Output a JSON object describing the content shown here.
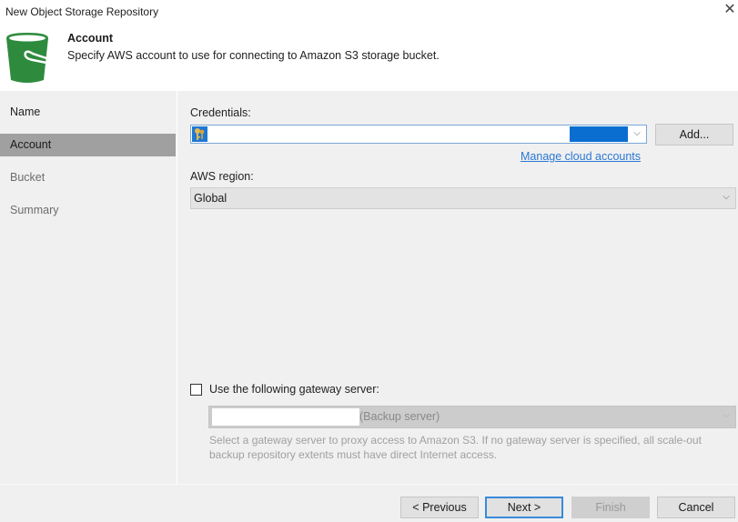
{
  "window": {
    "title": "New Object Storage Repository",
    "close_icon": "close-icon"
  },
  "header": {
    "icon": "s3-bucket-icon",
    "step_title": "Account",
    "step_description": "Specify AWS account to use for connecting to Amazon S3 storage bucket.",
    "accent_color": "#2e8b3e"
  },
  "sidebar": {
    "items": [
      {
        "label": "Name",
        "state": "done"
      },
      {
        "label": "Account",
        "state": "active"
      },
      {
        "label": "Bucket",
        "state": "pending"
      },
      {
        "label": "Summary",
        "state": "pending"
      }
    ]
  },
  "form": {
    "credentials_label": "Credentials:",
    "credentials_value": "",
    "credentials_icon": "key-icon",
    "add_button": "Add...",
    "manage_link": "Manage cloud accounts",
    "region_label": "AWS region:",
    "region_value": "Global",
    "gateway_checkbox_label": "Use the following gateway server:",
    "gateway_checked": false,
    "gateway_server_value": "",
    "gateway_server_suffix": "(Backup server)",
    "gateway_help": "Select a gateway server to proxy access to Amazon S3. If no gateway server is specified, all scale-out backup repository extents must have direct Internet access."
  },
  "footer": {
    "previous": "< Previous",
    "next": "Next >",
    "finish": "Finish",
    "cancel": "Cancel"
  }
}
